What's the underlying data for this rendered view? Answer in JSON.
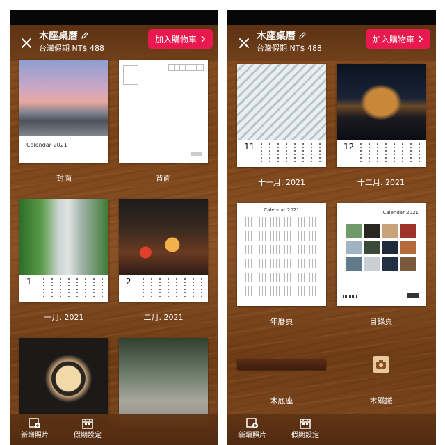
{
  "header": {
    "title": "木座桌曆",
    "subtitle": "台灣假期 NT$ 488",
    "cart_label": "加入購物車"
  },
  "left_items": [
    {
      "caption": "封面",
      "card_text": "Calendar  2021"
    },
    {
      "caption": "背面"
    },
    {
      "caption": "一月. 2021",
      "month": "1"
    },
    {
      "caption": "二月. 2021",
      "month": "2"
    }
  ],
  "right_items": [
    {
      "caption": "十一月. 2021",
      "month": "11"
    },
    {
      "caption": "十二月. 2021",
      "month": "12"
    },
    {
      "caption": "年曆頁",
      "card_text": "Calendar  2021"
    },
    {
      "caption": "目錄頁",
      "card_text": "Calendar  2021"
    },
    {
      "caption": "木底座"
    },
    {
      "caption": "木磁鐵"
    }
  ],
  "bottombar": {
    "add_photo_label": "新增照片",
    "holiday_label": "假期設定"
  },
  "colors": {
    "accent": "#e8194e",
    "wood": "#7a4419"
  }
}
